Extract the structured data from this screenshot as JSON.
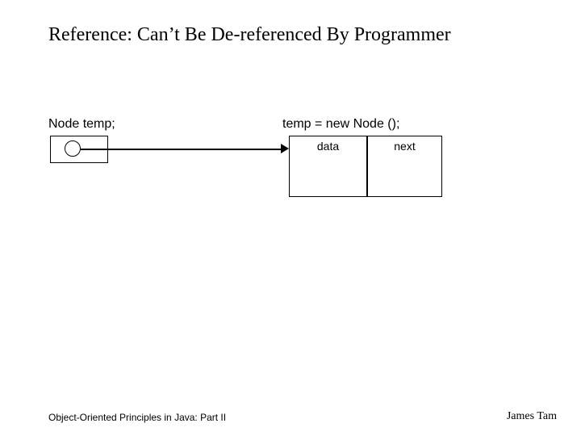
{
  "title": "Reference: Can’t Be De-referenced By Programmer",
  "left_label": "Node temp;",
  "right_label": "temp = new Node ();",
  "node": {
    "data_label": "data",
    "next_label": "next"
  },
  "footer": {
    "left": "Object-Oriented Principles in Java: Part II",
    "right": "James Tam"
  }
}
